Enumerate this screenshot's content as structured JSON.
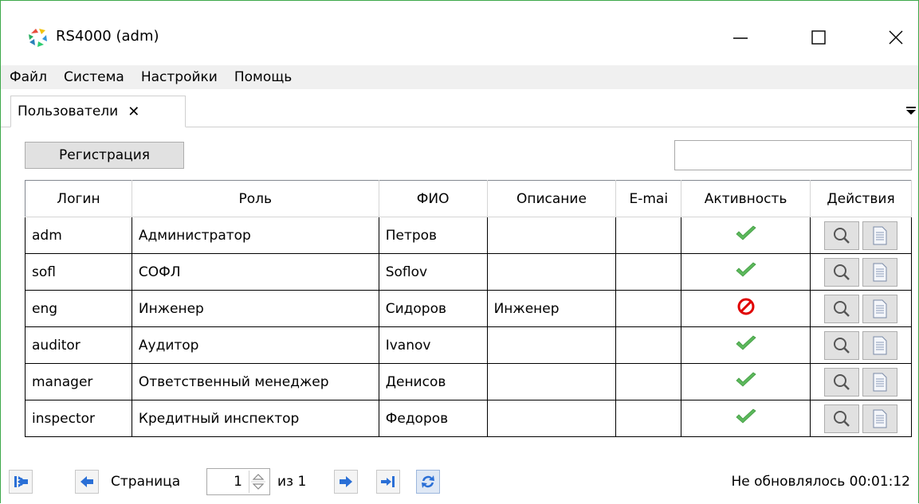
{
  "window": {
    "title": "RS4000 (adm)"
  },
  "menu": {
    "items": [
      "Файл",
      "Система",
      "Настройки",
      "Помощь"
    ]
  },
  "tabs": [
    {
      "label": "Пользователи",
      "close": "✕"
    }
  ],
  "toolbar": {
    "register_label": "Регистрация",
    "search_value": ""
  },
  "table": {
    "columns": [
      "Логин",
      "Роль",
      "ФИО",
      "Описание",
      "E-mai",
      "Активность",
      "Действия"
    ],
    "rows": [
      {
        "login": "adm",
        "role": "Администратор",
        "fio": "Петров",
        "description": "",
        "email": "",
        "active": true
      },
      {
        "login": "sofl",
        "role": "СОФЛ",
        "fio": "Soflov",
        "description": "",
        "email": "",
        "active": true
      },
      {
        "login": "eng",
        "role": "Инженер",
        "fio": "Сидоров",
        "description": "Инженер",
        "email": "",
        "active": false
      },
      {
        "login": "auditor",
        "role": "Аудитор",
        "fio": "Ivanov",
        "description": "",
        "email": "",
        "active": true
      },
      {
        "login": "manager",
        "role": "Ответственный менеджер",
        "fio": "Денисов",
        "description": "",
        "email": "",
        "active": true
      },
      {
        "login": "inspector",
        "role": "Кредитный инспектор",
        "fio": "Федоров",
        "description": "",
        "email": "",
        "active": true
      }
    ]
  },
  "pager": {
    "page_label": "Страница",
    "page_value": "1",
    "of_label": "из 1"
  },
  "status": {
    "text": "Не обновлялось 00:01:12"
  },
  "colors": {
    "accent_border": "#3da84a",
    "active_check": "#5cb85c",
    "inactive_icon": "#e00000",
    "pager_arrow": "#2a6fd6"
  },
  "icons": {
    "active": "check-icon",
    "inactive": "blocked-icon",
    "view": "magnifier-icon",
    "edit": "document-icon"
  }
}
